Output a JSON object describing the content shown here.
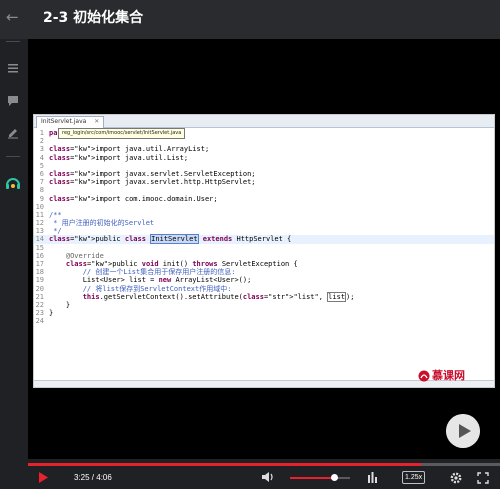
{
  "header": {
    "title": "2-3 初始化集合"
  },
  "sidebar": {
    "icons": [
      "list-icon",
      "comment-icon",
      "edit-icon",
      "headset-icon"
    ]
  },
  "editor": {
    "tab_label": "InitServlet.java",
    "tab_close": "✕",
    "tooltip": "reg_login/src/com/imooc/servlet/InitServlet.java",
    "lines": [
      {
        "n": "1",
        "t": "pa"
      },
      {
        "n": "2",
        "t": ""
      },
      {
        "n": "3",
        "t": "import java.util.ArrayList;"
      },
      {
        "n": "4",
        "t": "import java.util.List;"
      },
      {
        "n": "5",
        "t": ""
      },
      {
        "n": "6",
        "t": "import javax.servlet.ServletException;"
      },
      {
        "n": "7",
        "t": "import javax.servlet.http.HttpServlet;"
      },
      {
        "n": "8",
        "t": ""
      },
      {
        "n": "9",
        "t": "import com.imooc.domain.User;"
      },
      {
        "n": "10",
        "t": ""
      },
      {
        "n": "11",
        "t": "/**"
      },
      {
        "n": "12",
        "t": " * 用户注册的初始化的Servlet"
      },
      {
        "n": "13",
        "t": " */"
      },
      {
        "n": "14",
        "t": "public class InitServlet extends HttpServlet {"
      },
      {
        "n": "15",
        "t": ""
      },
      {
        "n": "16",
        "t": "    @Override"
      },
      {
        "n": "17",
        "t": "    public void init() throws ServletException {"
      },
      {
        "n": "18",
        "t": "        // 创建一个List集合用于保存用户注册的信息:"
      },
      {
        "n": "19",
        "t": "        List<User> list = new ArrayList<User>();"
      },
      {
        "n": "20",
        "t": "        // 将list保存到ServletContext作用域中:"
      },
      {
        "n": "21",
        "t": "        this.getServletContext().setAttribute(\"list\", list);"
      },
      {
        "n": "22",
        "t": "    }"
      },
      {
        "n": "23",
        "t": "}"
      },
      {
        "n": "24",
        "t": ""
      }
    ]
  },
  "watermark": {
    "text": "慕课网"
  },
  "player": {
    "current_time": "3:25",
    "time_separator": " / ",
    "duration": "4:06",
    "progress_fraction": 0.833,
    "volume_fraction": 0.73,
    "speed": "1.25x"
  },
  "colors": {
    "accent": "#e8222d",
    "header_bg": "#2a2b2e",
    "sidebar_bg": "#202124"
  }
}
